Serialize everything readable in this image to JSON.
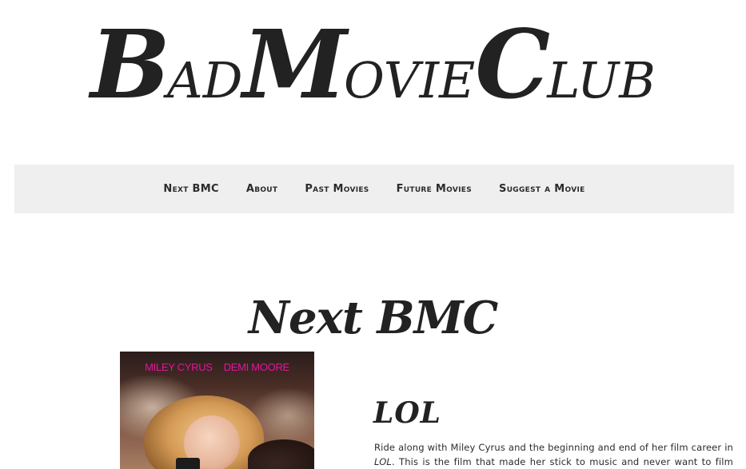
{
  "site": {
    "logo": {
      "part1_big": "B",
      "part1_small": "AD",
      "part2_big": "M",
      "part2_small": "OVIE",
      "part3_big": "C",
      "part3_small": "LUB"
    }
  },
  "nav": {
    "items": [
      {
        "label": "Next BMC"
      },
      {
        "label": "About"
      },
      {
        "label": "Past Movies"
      },
      {
        "label": "Future Movies"
      },
      {
        "label": "Suggest a Movie"
      }
    ]
  },
  "main": {
    "section_title": "Next BMC",
    "poster": {
      "actor1": "MILEY CYRUS",
      "actor2": "DEMI MOORE"
    },
    "movie": {
      "title": "LOL",
      "desc_part1": "Ride along with Miley Cyrus and the beginning and end of her film career in ",
      "desc_movie": "LOL",
      "desc_part2": ". This is the film that made her stick to music and never want to film again."
    }
  }
}
